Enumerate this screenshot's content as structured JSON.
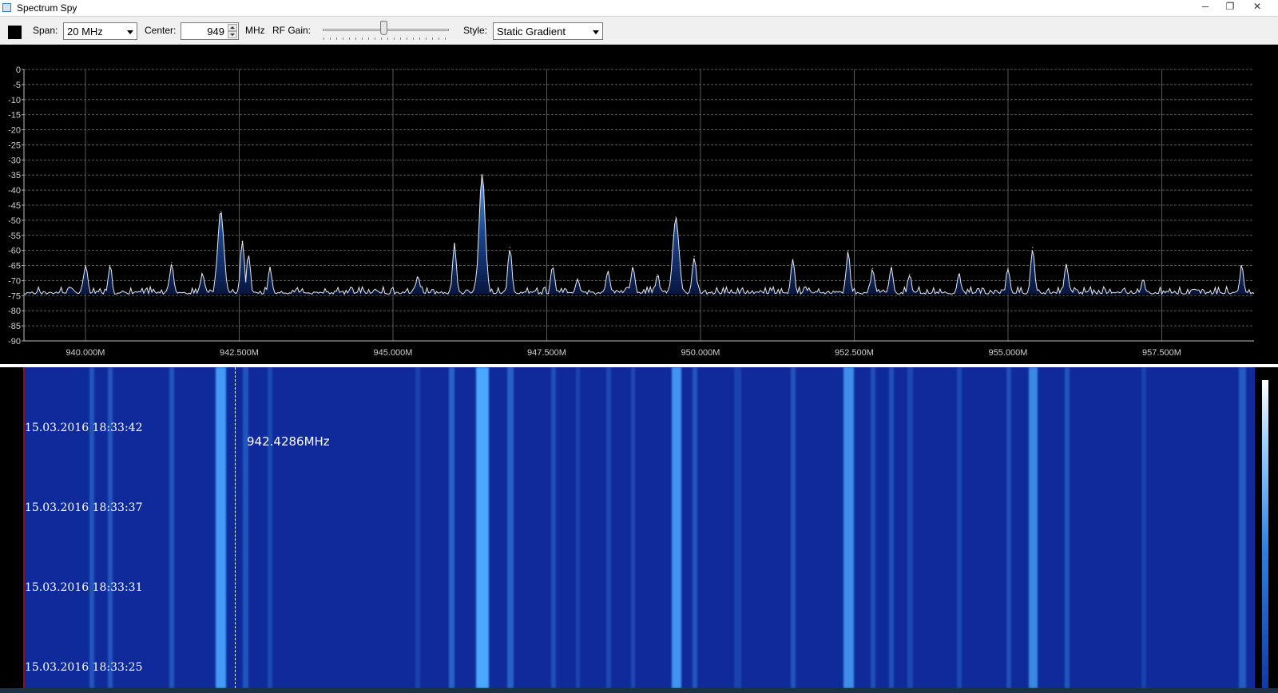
{
  "window": {
    "title": "Spectrum Spy",
    "minimize_icon": "minimize-icon",
    "maximize_icon": "maximize-icon",
    "close_icon": "close-icon"
  },
  "toolbar": {
    "color_swatch": "#000000",
    "span_label": "Span:",
    "span_value": "20 MHz",
    "center_label": "Center:",
    "center_value": "949",
    "center_unit": "MHz",
    "rf_gain_label": "RF Gain:",
    "rf_gain_level": 0.48,
    "style_label": "Style:",
    "style_value": "Static Gradient"
  },
  "chart_data": {
    "type": "line",
    "y_ticks": [
      "0",
      "-5",
      "-10",
      "-15",
      "-20",
      "-25",
      "-30",
      "-35",
      "-40",
      "-45",
      "-50",
      "-55",
      "-60",
      "-65",
      "-70",
      "-75",
      "-80",
      "-85",
      "-90"
    ],
    "ylim": [
      -90,
      0
    ],
    "xlim": [
      939.0,
      959.0
    ],
    "x_ticks": [
      {
        "v": 940.0,
        "label": "940.000M"
      },
      {
        "v": 942.5,
        "label": "942.500M"
      },
      {
        "v": 945.0,
        "label": "945.000M"
      },
      {
        "v": 947.5,
        "label": "947.500M"
      },
      {
        "v": 950.0,
        "label": "950.000M"
      },
      {
        "v": 952.5,
        "label": "952.500M"
      },
      {
        "v": 955.0,
        "label": "955.000M"
      },
      {
        "v": 957.5,
        "label": "957.500M"
      }
    ],
    "grid": true,
    "noise_floor": -74.5,
    "peaks": [
      {
        "x": 940.0,
        "y": -65
      },
      {
        "x": 940.4,
        "y": -65
      },
      {
        "x": 941.4,
        "y": -64
      },
      {
        "x": 941.9,
        "y": -68
      },
      {
        "x": 942.2,
        "y": -47
      },
      {
        "x": 942.55,
        "y": -57
      },
      {
        "x": 942.65,
        "y": -62
      },
      {
        "x": 943.0,
        "y": -66
      },
      {
        "x": 945.4,
        "y": -69
      },
      {
        "x": 946.0,
        "y": -58
      },
      {
        "x": 946.45,
        "y": -35
      },
      {
        "x": 946.9,
        "y": -59
      },
      {
        "x": 947.6,
        "y": -65
      },
      {
        "x": 948.0,
        "y": -70
      },
      {
        "x": 948.5,
        "y": -67
      },
      {
        "x": 948.9,
        "y": -66
      },
      {
        "x": 949.3,
        "y": -68
      },
      {
        "x": 949.6,
        "y": -49
      },
      {
        "x": 949.9,
        "y": -62
      },
      {
        "x": 951.5,
        "y": -63
      },
      {
        "x": 952.4,
        "y": -60
      },
      {
        "x": 952.8,
        "y": -66
      },
      {
        "x": 953.1,
        "y": -66
      },
      {
        "x": 953.4,
        "y": -68
      },
      {
        "x": 954.2,
        "y": -68
      },
      {
        "x": 955.0,
        "y": -66
      },
      {
        "x": 955.4,
        "y": -59
      },
      {
        "x": 955.95,
        "y": -65
      },
      {
        "x": 957.2,
        "y": -70
      },
      {
        "x": 958.8,
        "y": -65
      }
    ]
  },
  "waterfall": {
    "cursor_freq": 942.4286,
    "cursor_label": "942.4286MHz",
    "timestamps": [
      "15.03.2016 18:33:42",
      "15.03.2016 18:33:37",
      "15.03.2016 18:33:31",
      "15.03.2016 18:33:25"
    ],
    "base_color": "#0f2a9a",
    "band_color": "#4aa8ff",
    "bands": [
      {
        "x": 940.1,
        "w": 0.08,
        "a": 0.35
      },
      {
        "x": 940.4,
        "w": 0.08,
        "a": 0.35
      },
      {
        "x": 941.4,
        "w": 0.07,
        "a": 0.35
      },
      {
        "x": 942.2,
        "w": 0.16,
        "a": 0.9
      },
      {
        "x": 942.6,
        "w": 0.1,
        "a": 0.35
      },
      {
        "x": 943.0,
        "w": 0.08,
        "a": 0.25
      },
      {
        "x": 945.4,
        "w": 0.08,
        "a": 0.2
      },
      {
        "x": 945.95,
        "w": 0.1,
        "a": 0.45
      },
      {
        "x": 946.45,
        "w": 0.2,
        "a": 1.0
      },
      {
        "x": 946.9,
        "w": 0.1,
        "a": 0.45
      },
      {
        "x": 947.6,
        "w": 0.08,
        "a": 0.3
      },
      {
        "x": 948.0,
        "w": 0.07,
        "a": 0.22
      },
      {
        "x": 948.5,
        "w": 0.07,
        "a": 0.25
      },
      {
        "x": 948.9,
        "w": 0.07,
        "a": 0.25
      },
      {
        "x": 949.6,
        "w": 0.16,
        "a": 0.85
      },
      {
        "x": 949.9,
        "w": 0.08,
        "a": 0.35
      },
      {
        "x": 950.6,
        "w": 0.12,
        "a": 0.2
      },
      {
        "x": 951.5,
        "w": 0.08,
        "a": 0.35
      },
      {
        "x": 952.4,
        "w": 0.16,
        "a": 0.8
      },
      {
        "x": 952.8,
        "w": 0.08,
        "a": 0.3
      },
      {
        "x": 953.1,
        "w": 0.08,
        "a": 0.3
      },
      {
        "x": 953.4,
        "w": 0.08,
        "a": 0.25
      },
      {
        "x": 954.2,
        "w": 0.08,
        "a": 0.25
      },
      {
        "x": 955.0,
        "w": 0.08,
        "a": 0.3
      },
      {
        "x": 955.4,
        "w": 0.14,
        "a": 0.75
      },
      {
        "x": 955.95,
        "w": 0.08,
        "a": 0.35
      },
      {
        "x": 957.2,
        "w": 0.08,
        "a": 0.2
      },
      {
        "x": 958.8,
        "w": 0.12,
        "a": 0.4
      }
    ]
  }
}
